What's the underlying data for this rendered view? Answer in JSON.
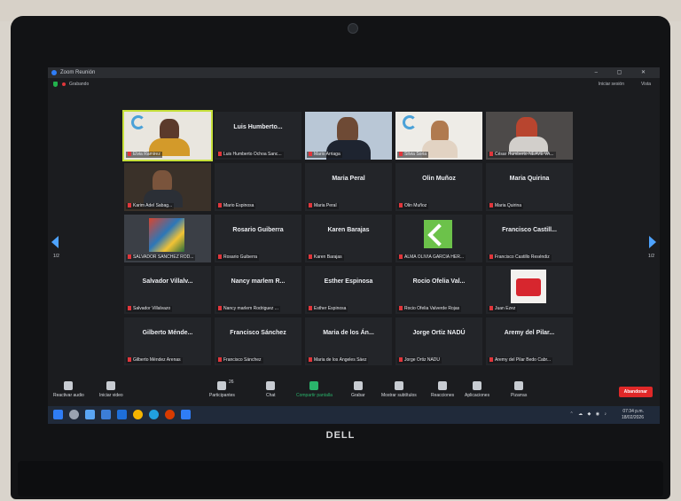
{
  "window": {
    "title": "Zoom Reunión",
    "recording": "Grabando",
    "exit_fullscreen": "Iniciar sesión",
    "view": "Vista"
  },
  "pagination": {
    "left": "1/2",
    "right": "1/2"
  },
  "tiles": [
    {
      "big": "",
      "label": "Elvia Ramirez",
      "video": true,
      "active": true
    },
    {
      "big": "Luis Humberto...",
      "label": "Luis Humberto Ochoa Sanc..."
    },
    {
      "big": "",
      "label": "Mario Arriaga",
      "video": true
    },
    {
      "big": "",
      "label": "Silvia Soria",
      "video": true
    },
    {
      "big": "",
      "label": "César Humberto NEAVE VA...",
      "video": true
    },
    {
      "big": "",
      "label": "Karim Adel Sabag...",
      "video": true
    },
    {
      "big": "",
      "label": "Mario Espinosa"
    },
    {
      "big": "Maria Peral",
      "label": "Maria Peral"
    },
    {
      "big": "Olin Muñoz",
      "label": "Olin Muñoz"
    },
    {
      "big": "Maria Quirina",
      "label": "Maria Quirina"
    },
    {
      "big": "",
      "label": "SALVADOR SANCHEZ ROD...",
      "video": true
    },
    {
      "big": "Rosario Guiberra",
      "label": "Rosario Guiberra"
    },
    {
      "big": "Karen Barajas",
      "label": "Karen Barajas"
    },
    {
      "big": "",
      "label": "ALMA OLIVIA GARCIA HER..."
    },
    {
      "big": "Francisco Castill...",
      "label": "Francisco Castillo Reséndiz"
    },
    {
      "big": "Salvador Villalv...",
      "label": "Salvador Villalvazo"
    },
    {
      "big": "Nancy marlem R...",
      "label": "Nancy marlem Rodriguez ..."
    },
    {
      "big": "Esther Espinosa",
      "label": "Esther Espinosa"
    },
    {
      "big": "Rocio Ofelia Val...",
      "label": "Rocio Ofelia Valverde Rojas"
    },
    {
      "big": "",
      "label": "Juan Ezez"
    },
    {
      "big": "Gilberto Ménde...",
      "label": "Gilberto Méndez Arenas"
    },
    {
      "big": "Francisco Sánchez",
      "label": "Francisco Sánchez"
    },
    {
      "big": "Maria de los Án...",
      "label": "Maria de los Ángeles Sáez"
    },
    {
      "big": "Jorge Ortiz NADÚ",
      "label": "Jorge Ortiz NADÚ"
    },
    {
      "big": "Aremy del Pilar...",
      "label": "Aremy del Pilar Bedo Cabr..."
    }
  ],
  "toolbar": {
    "audio": "Reactivar audio",
    "video": "Iniciar video",
    "participants_count": "26",
    "participants": "Participantes",
    "chat": "Chat",
    "share": "Compartir pantalla",
    "record": "Grabar",
    "captions": "Mostrar subtítulos",
    "reactions": "Reacciones",
    "apps": "Aplicaciones",
    "whiteboard": "Pizarras",
    "leave": "Abandonar"
  },
  "taskbar": {
    "time": "07:34 p.m.",
    "date": "18/02/2026"
  },
  "brand": {
    "logo": "DELL"
  },
  "colors": {
    "accent": "#2f7df6",
    "active_speaker": "#c6e03a",
    "leave": "#e02828",
    "share": "#2ab36b"
  }
}
